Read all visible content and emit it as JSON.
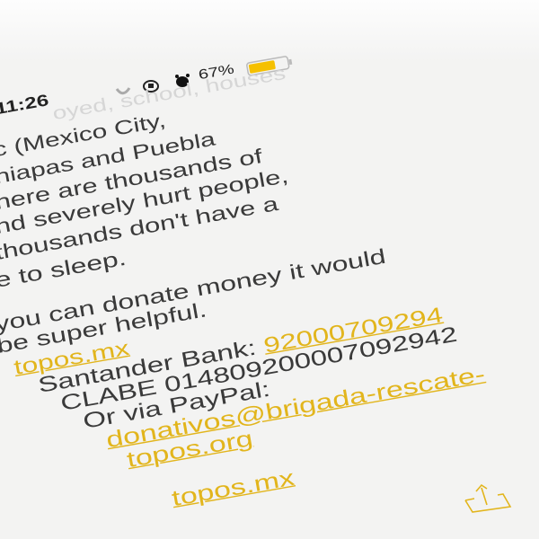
{
  "status_bar": {
    "time": "11:26",
    "battery_percent": "67%",
    "battery_level": 0.67,
    "battery_color": "#f5c000",
    "icons": [
      "moon-icon",
      "orientation-lock-icon",
      "alarm-icon",
      "battery-icon"
    ]
  },
  "note": {
    "faint_line": "oyed, school, houses",
    "lines": [
      "c (Mexico City,",
      "hiapas and Puebla",
      "here are thousands of",
      "nd severely hurt people,",
      "thousands don't have a",
      "e to sleep.",
      "you can donate money it would",
      "be super helpful."
    ],
    "link_topos_mx": "topos.mx",
    "santander_label": "Santander Bank: ",
    "santander_account": "920007092​94",
    "clabe": "CLABE 014809200007092942",
    "paypal_label": "Or via PayPal:",
    "paypal_email_1": "donativos@brigada-rescate-",
    "paypal_email_2": "topos.org",
    "link_topos_mx_2": "topos.mx"
  },
  "toolbar": {
    "share_icon": "share-icon"
  },
  "colors": {
    "link": "#e2b51c",
    "text": "#3a3a3a",
    "background": "#f3f3f2"
  }
}
